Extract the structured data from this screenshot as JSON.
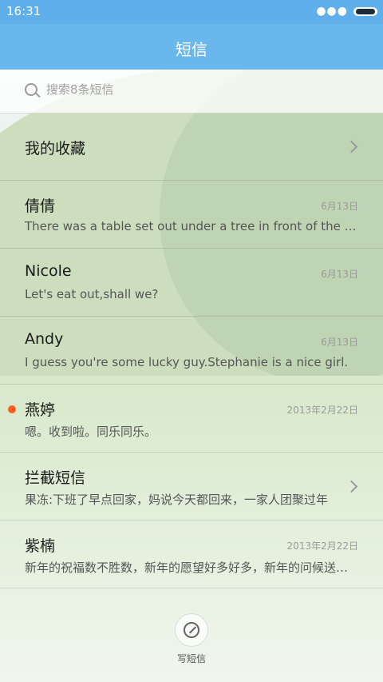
{
  "status": {
    "time": "16:31",
    "icons": [
      "more-dots-icon",
      "battery-icon"
    ]
  },
  "header": {
    "title": "短信"
  },
  "search": {
    "placeholder": "搜索8条短信",
    "icon": "search-icon"
  },
  "favorites": {
    "label": "我的收藏"
  },
  "conversations": [
    {
      "name": "倩倩",
      "date": "6月13日",
      "preview": "There was a table set out under a tree in front of the house"
    },
    {
      "name": "Nicole",
      "date": "6月13日",
      "preview": "Let's eat out,shall we?"
    },
    {
      "name": "Andy",
      "date": "6月13日",
      "preview": "I guess you're some lucky guy.Stephanie is a nice girl."
    },
    {
      "name": "燕婷",
      "date": "2013年2月22日",
      "preview": "嗯。收到啦。同乐同乐。",
      "unread": true
    },
    {
      "name": "拦截短信",
      "date": "",
      "preview": "果冻:下班了早点回家，妈说今天都回来，一家人团聚过年",
      "has_arrow": true
    },
    {
      "name": "紫楠",
      "date": "2013年2月22日",
      "preview": "新年的祝福数不胜数，新年的愿望好多好多，新年的问候送给你"
    }
  ],
  "compose": {
    "label": "写短信",
    "icon": "compose-icon"
  },
  "colors": {
    "header": "#6ab7ee",
    "statusbar": "#5fb0ea",
    "unread": "#ff5a1f"
  }
}
